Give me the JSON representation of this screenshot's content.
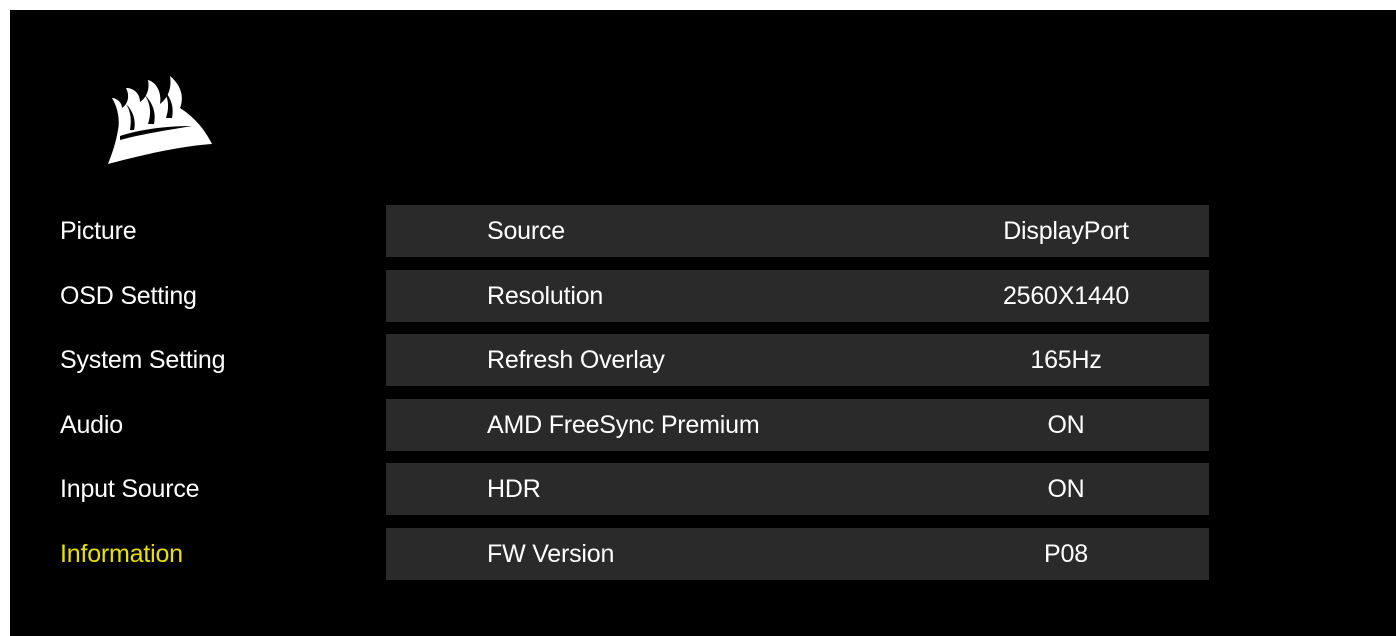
{
  "logo": {
    "icon": "corsair-sails-logo-icon"
  },
  "menu": {
    "active_color": "#e8e000",
    "items": [
      {
        "label": "Picture",
        "active": false
      },
      {
        "label": "OSD Setting",
        "active": false
      },
      {
        "label": "System Setting",
        "active": false
      },
      {
        "label": "Audio",
        "active": false
      },
      {
        "label": "Input Source",
        "active": false
      },
      {
        "label": "Information",
        "active": true
      }
    ]
  },
  "info": {
    "rows": [
      {
        "label": "Source",
        "value": "DisplayPort"
      },
      {
        "label": "Resolution",
        "value": "2560X1440"
      },
      {
        "label": "Refresh Overlay",
        "value": "165Hz"
      },
      {
        "label": "AMD FreeSync Premium",
        "value": "ON"
      },
      {
        "label": "HDR",
        "value": "ON"
      },
      {
        "label": "FW Version",
        "value": "P08"
      }
    ]
  }
}
